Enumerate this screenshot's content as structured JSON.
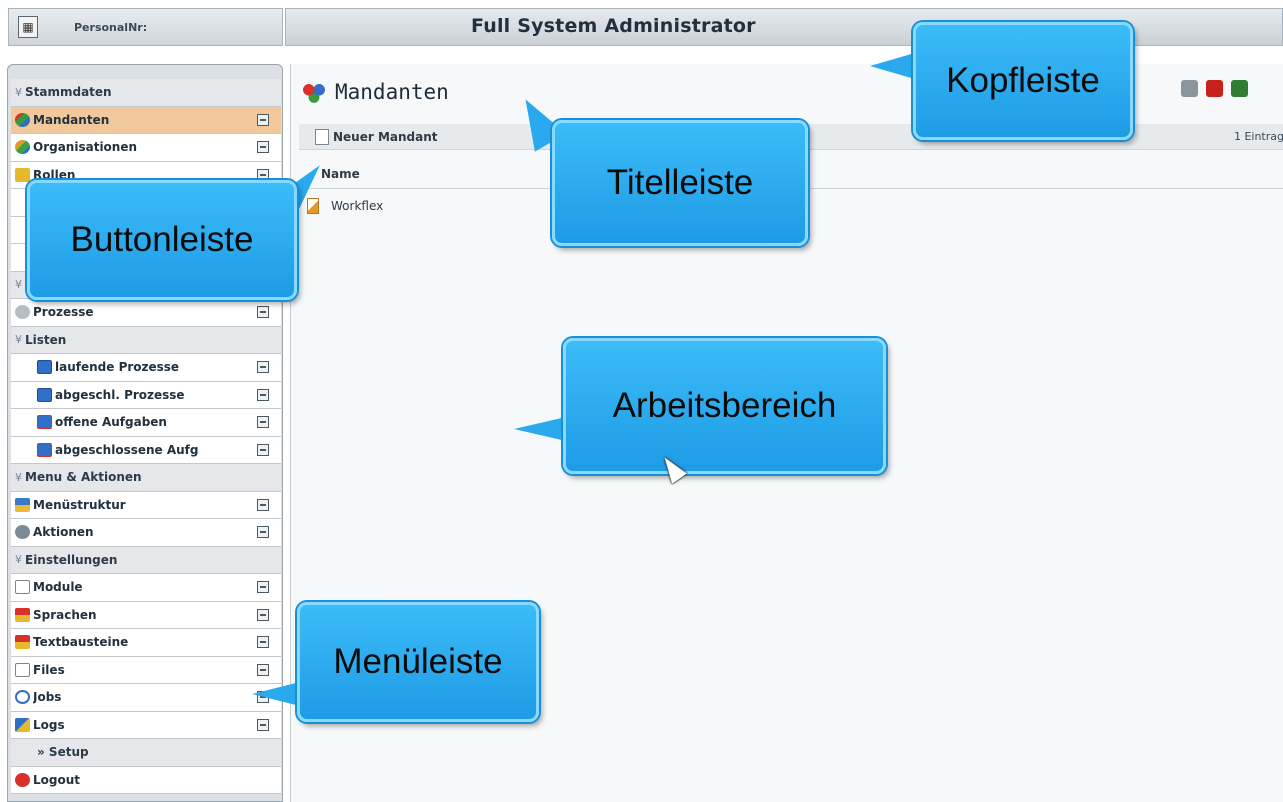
{
  "header": {
    "personal_label": "PersonalNr:",
    "title": "Full System Administrator"
  },
  "sidebar": {
    "rows": [
      {
        "type": "section",
        "label": "Stammdaten"
      },
      {
        "type": "item",
        "label": "Mandanten",
        "icon": "clients-icon",
        "active": true,
        "ext": true
      },
      {
        "type": "item",
        "label": "Organisationen",
        "icon": "organizations-icon",
        "ext": true
      },
      {
        "type": "item",
        "label": "Rollen",
        "icon": "roles-icon",
        "ext": true
      },
      {
        "type": "item",
        "label": "",
        "icon": "",
        "ext": false
      },
      {
        "type": "item",
        "label": "",
        "icon": "",
        "ext": false
      },
      {
        "type": "item",
        "label": "",
        "icon": "",
        "ext": false
      },
      {
        "type": "section",
        "label": ""
      },
      {
        "type": "item",
        "label": "Prozesse",
        "icon": "process-icon",
        "ext": true
      },
      {
        "type": "section",
        "label": "Listen"
      },
      {
        "type": "sub",
        "label": "laufende Prozesse",
        "icon": "list-icon",
        "ext": true
      },
      {
        "type": "sub",
        "label": "abgeschl. Prozesse",
        "icon": "list-icon",
        "ext": true
      },
      {
        "type": "sub",
        "label": "offene Aufgaben",
        "icon": "task-icon",
        "ext": true
      },
      {
        "type": "sub",
        "label": "abgeschlossene Aufg",
        "icon": "task-icon",
        "ext": true
      },
      {
        "type": "section",
        "label": "Menu & Aktionen"
      },
      {
        "type": "item",
        "label": "Menüstruktur",
        "icon": "menu-structure-icon",
        "ext": true
      },
      {
        "type": "item",
        "label": "Aktionen",
        "icon": "actions-icon",
        "ext": true
      },
      {
        "type": "section",
        "label": "Einstellungen"
      },
      {
        "type": "item",
        "label": "Module",
        "icon": "module-icon",
        "ext": true
      },
      {
        "type": "item",
        "label": "Sprachen",
        "icon": "languages-icon",
        "ext": true
      },
      {
        "type": "item",
        "label": "Textbausteine",
        "icon": "text-blocks-icon",
        "ext": true
      },
      {
        "type": "item",
        "label": "Files",
        "icon": "files-icon",
        "ext": true
      },
      {
        "type": "item",
        "label": "Jobs",
        "icon": "jobs-icon",
        "ext": true
      },
      {
        "type": "item",
        "label": "Logs",
        "icon": "logs-icon",
        "ext": true
      },
      {
        "type": "section",
        "label": "» Setup",
        "collapsed": true
      },
      {
        "type": "item",
        "label": "Logout",
        "icon": "logout-icon",
        "ext": false
      }
    ]
  },
  "main": {
    "title": "Mandanten",
    "new_button": "Neuer Mandant",
    "entries_count": "1 Eintrag",
    "column_name": "Name",
    "rows": [
      "Workflex"
    ]
  },
  "callouts": {
    "kopfleiste": "Kopfleiste",
    "titelleiste": "Titelleiste",
    "buttonleiste": "Buttonleiste",
    "arbeitsbereich": "Arbeitsbereich",
    "menueleiste": "Menüleiste"
  },
  "colors": {
    "accent_bubble": "#2aa9ee",
    "active_item": "#f0c89b"
  }
}
